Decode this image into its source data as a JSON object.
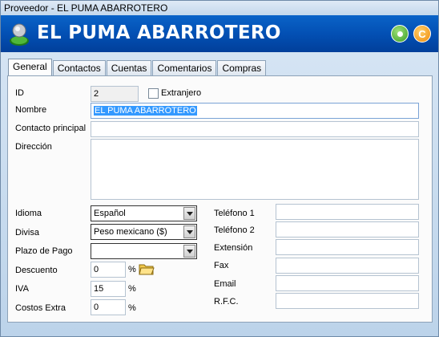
{
  "window": {
    "title": "Proveedor - EL PUMA ABARROTERO"
  },
  "header": {
    "title": "EL PUMA ABARROTERO",
    "btn_ok_icon": "green-circle-icon",
    "btn_alt_icon": "orange-refresh-icon"
  },
  "tabs": [
    {
      "label": "General"
    },
    {
      "label": "Contactos"
    },
    {
      "label": "Cuentas"
    },
    {
      "label": "Comentarios"
    },
    {
      "label": "Compras"
    }
  ],
  "form": {
    "id_label": "ID",
    "id_value": "2",
    "extranjero_label": "Extranjero",
    "extranjero_checked": false,
    "nombre_label": "Nombre",
    "nombre_value": "EL PUMA ABARROTERO",
    "contacto_label": "Contacto principal",
    "contacto_value": "",
    "direccion_label": "Dirección",
    "direccion_value": "",
    "idioma_label": "Idioma",
    "idioma_value": "Español",
    "divisa_label": "Divisa",
    "divisa_value": "Peso mexicano ($)",
    "plazo_label": "Plazo de Pago",
    "plazo_value": "",
    "descuento_label": "Descuento",
    "descuento_value": "0",
    "iva_label": "IVA",
    "iva_value": "15",
    "costos_label": "Costos Extra",
    "costos_value": "0",
    "percent": "%",
    "telefono1_label": "Teléfono 1",
    "telefono1_value": "",
    "telefono2_label": "Teléfono 2",
    "telefono2_value": "",
    "extension_label": "Extensión",
    "extension_value": "",
    "fax_label": "Fax",
    "fax_value": "",
    "email_label": "Email",
    "email_value": "",
    "rfc_label": "R.F.C.",
    "rfc_value": ""
  }
}
